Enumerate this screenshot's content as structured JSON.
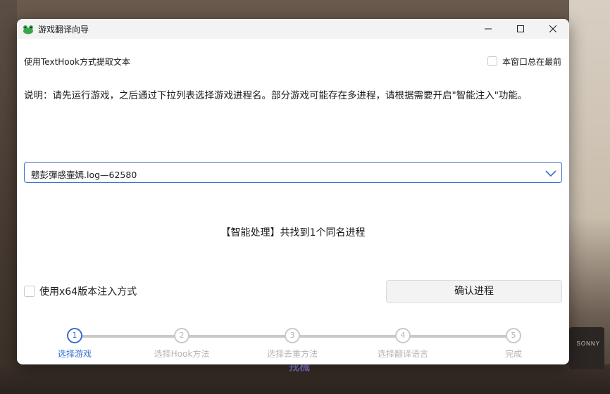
{
  "window": {
    "title": "游戏翻译向导",
    "controls": {
      "minimize": "minimize",
      "maximize": "maximize",
      "close": "close"
    }
  },
  "header": {
    "mode_label": "使用TextHook方式提取文本",
    "topmost_label": "本窗口总在最前",
    "topmost_checked": false
  },
  "description": "说明：请先运行游戏，之后通过下拉列表选择游戏进程名。部分游戏可能存在多进程，请根据需要开启\"智能注入\"功能。",
  "process_select": {
    "value": "戆彭彈惑壷嫣.log—62580"
  },
  "status": "【智能处理】共找到1个同名进程",
  "x64_option": {
    "label": "使用x64版本注入方式",
    "checked": false
  },
  "confirm_button": "确认进程",
  "steps": [
    {
      "number": "1",
      "label": "选择游戏",
      "active": true
    },
    {
      "number": "2",
      "label": "选择Hook方法",
      "active": false
    },
    {
      "number": "3",
      "label": "选择去重方法",
      "active": false
    },
    {
      "number": "4",
      "label": "选择翻译语言",
      "active": false
    },
    {
      "number": "5",
      "label": "完成",
      "active": false
    }
  ],
  "background": {
    "tv_brand": "SONNY",
    "overlay_text": "戎械"
  },
  "colors": {
    "accent": "#3a6fd0",
    "inactive": "#c9c9c9",
    "titlebar": "#f3f3f3"
  }
}
